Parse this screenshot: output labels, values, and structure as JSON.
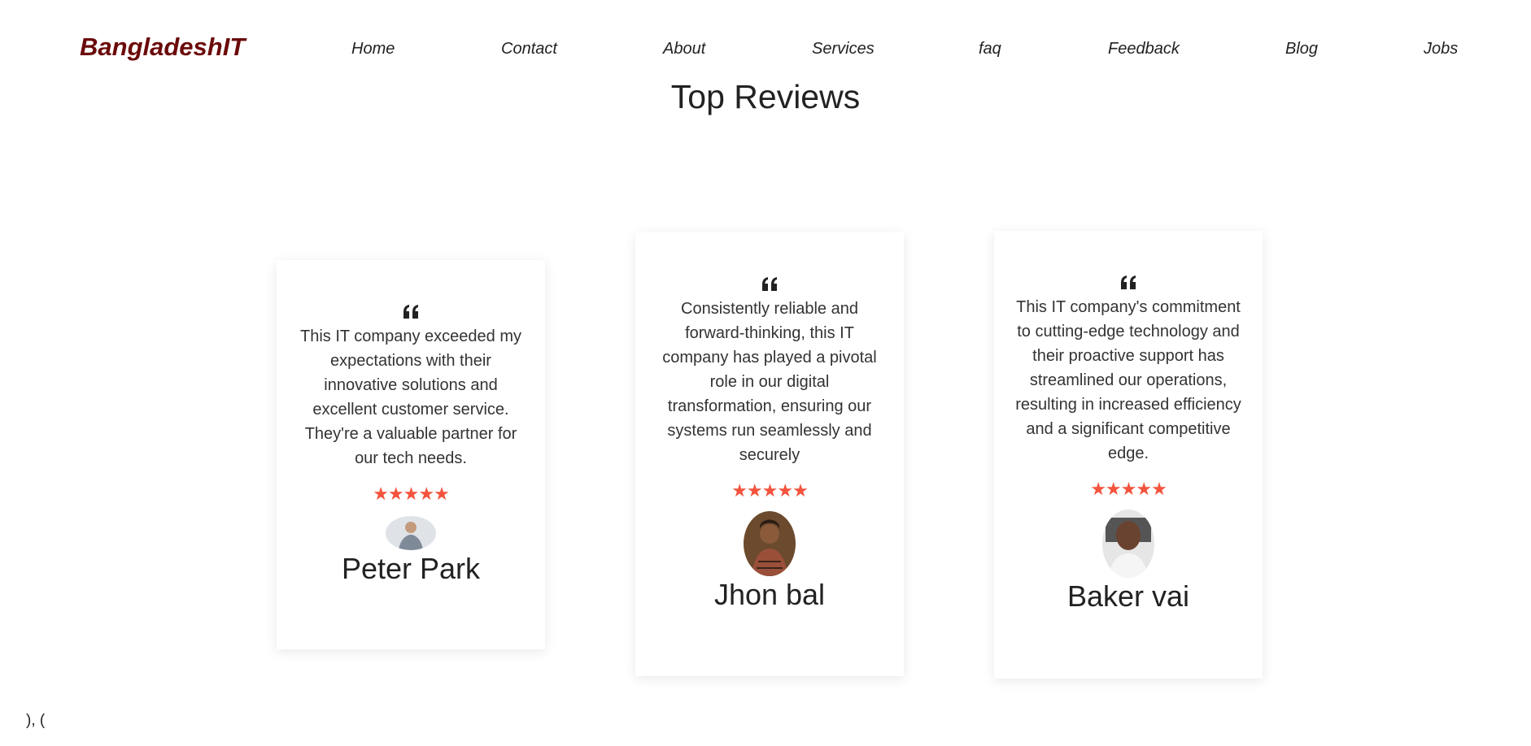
{
  "brand": "BangladeshIT",
  "nav": {
    "items": [
      "Home",
      "Contact",
      "About",
      "Services",
      "faq",
      "Feedback",
      "Blog",
      "Jobs"
    ]
  },
  "section_title": "Top Reviews",
  "reviews": [
    {
      "text": "This IT company exceeded my expectations with their innovative solutions and excellent customer service. They're a valuable partner for our tech needs.",
      "rating": 5,
      "stars": "★★★★★",
      "name": "Peter Park"
    },
    {
      "text": "Consistently reliable and forward-thinking, this IT company has played a pivotal role in our digital transformation, ensuring our systems run seamlessly and securely",
      "rating": 5,
      "stars": "★★★★★",
      "name": "Jhon bal"
    },
    {
      "text": "This IT company's commitment to cutting-edge technology and their proactive support has streamlined our operations, resulting in increased efficiency and a significant competitive edge.",
      "rating": 5,
      "stars": "★★★★★",
      "name": "Baker vai"
    }
  ],
  "footer_text": "), (",
  "colors": {
    "brand": "#6b0a0a",
    "stars": "#f4533d"
  },
  "icons": {
    "quote": "quote-left-icon"
  }
}
